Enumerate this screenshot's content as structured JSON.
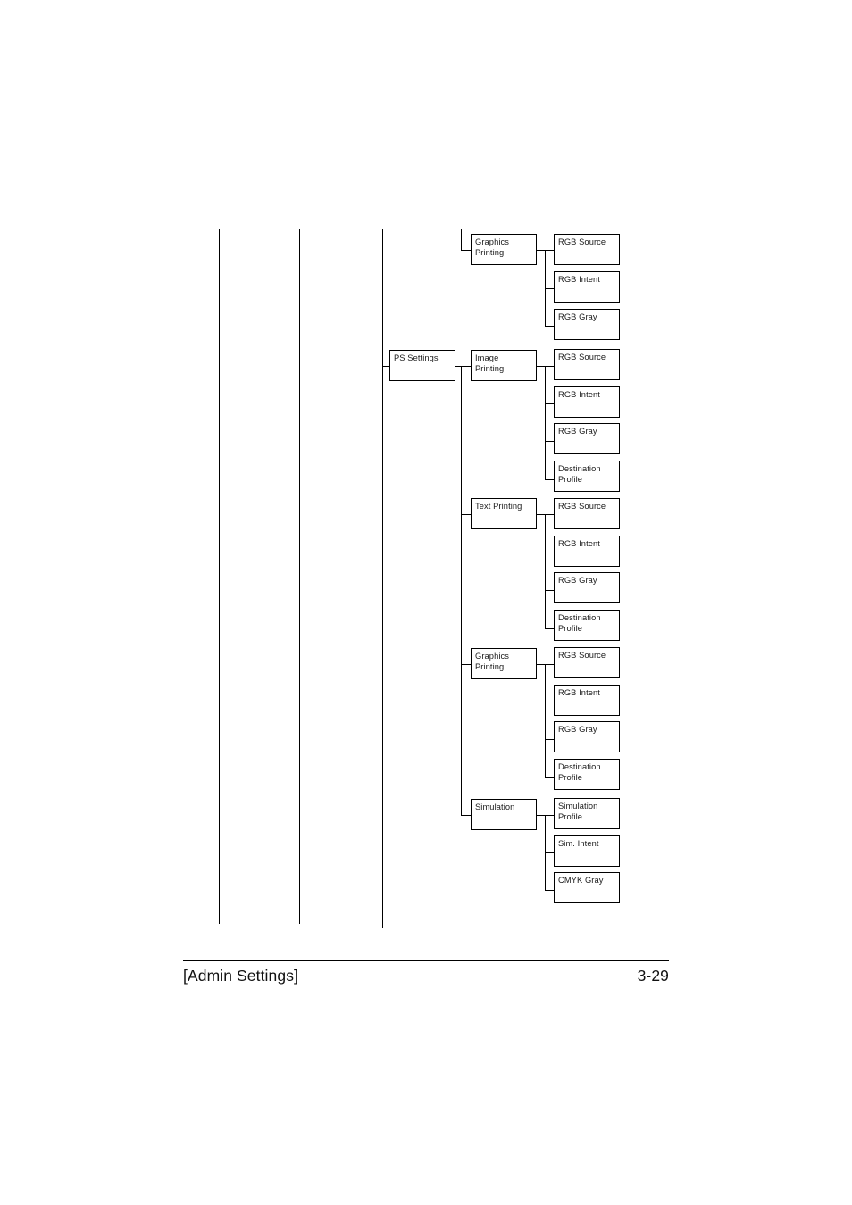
{
  "footer": {
    "left_label": "[Admin Settings]",
    "page_number": "3-29"
  },
  "diagram": {
    "type": "menu-tree",
    "continuation_lines": 3,
    "groups": [
      {
        "parent": null,
        "level2_label": "Graphics\nPrinting",
        "children": [
          "RGB Source",
          "RGB Intent",
          "RGB Gray"
        ]
      },
      {
        "parent": "PS Settings",
        "level2_label": "Image\nPrinting",
        "children": [
          "RGB Source",
          "RGB Intent",
          "RGB Gray",
          "Destination\nProfile"
        ]
      },
      {
        "parent": null,
        "level2_label": "Text Printing",
        "children": [
          "RGB Source",
          "RGB Intent",
          "RGB Gray",
          "Destination\nProfile"
        ]
      },
      {
        "parent": null,
        "level2_label": "Graphics\nPrinting",
        "children": [
          "RGB Source",
          "RGB Intent",
          "RGB Gray",
          "Destination\nProfile"
        ]
      },
      {
        "parent": null,
        "level2_label": "Simulation",
        "children": [
          "Simulation\nProfile",
          "Sim. Intent",
          "CMYK Gray"
        ]
      }
    ],
    "nodes": {
      "ps_settings": "PS Settings",
      "graphics_printing_1": "Graphics\nPrinting",
      "image_printing": "Image\nPrinting",
      "text_printing": "Text Printing",
      "graphics_printing_2": "Graphics\nPrinting",
      "simulation": "Simulation",
      "g1_rgb_source": "RGB Source",
      "g1_rgb_intent": "RGB Intent",
      "g1_rgb_gray": "RGB Gray",
      "img_rgb_source": "RGB Source",
      "img_rgb_intent": "RGB Intent",
      "img_rgb_gray": "RGB Gray",
      "img_destination_profile": "Destination\nProfile",
      "txt_rgb_source": "RGB Source",
      "txt_rgb_intent": "RGB Intent",
      "txt_rgb_gray": "RGB Gray",
      "txt_destination_profile": "Destination\nProfile",
      "g2_rgb_source": "RGB Source",
      "g2_rgb_intent": "RGB Intent",
      "g2_rgb_gray": "RGB Gray",
      "g2_destination_profile": "Destination\nProfile",
      "sim_simulation_profile": "Simulation\nProfile",
      "sim_sim_intent": "Sim. Intent",
      "sim_cmyk_gray": "CMYK Gray"
    }
  }
}
